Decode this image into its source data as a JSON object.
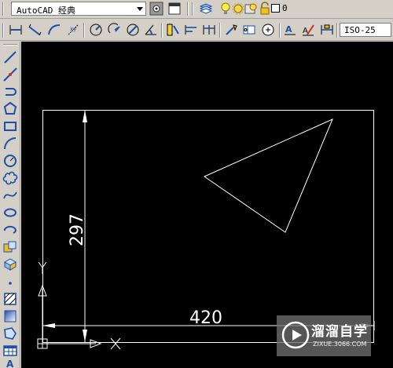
{
  "toolbar_top": {
    "workspace": "AutoCAD 经典",
    "current_layer": "0"
  },
  "toolbar_styles": {
    "dim_style": "ISO-25"
  },
  "drawing": {
    "dim_vertical": "297",
    "dim_horizontal": "420",
    "ucs_y": "Y",
    "ucs_x": "X"
  },
  "watermark": {
    "title": "溜溜自学",
    "url": "ZIXUE.3066.COM"
  },
  "colors": {
    "canvas_bg": "#000000",
    "lines": "#ffffff",
    "toolbar_bg": "#d4d0c8",
    "icon_blue": "#1d4fa8"
  }
}
